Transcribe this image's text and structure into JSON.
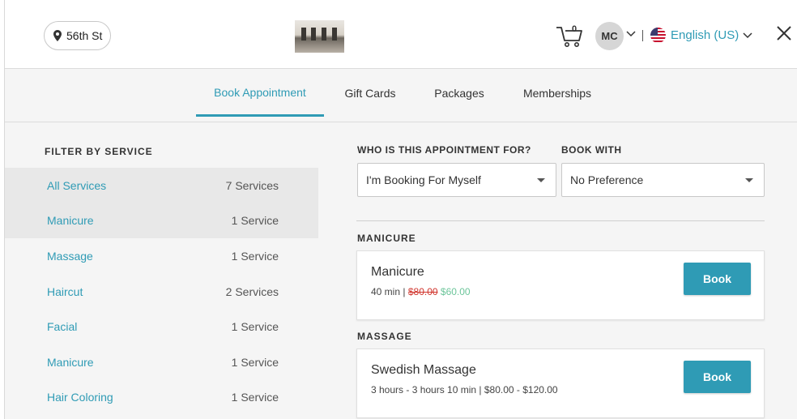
{
  "header": {
    "location": "56th St",
    "cart_count": "0",
    "user_initials": "MC",
    "language": "English (US)"
  },
  "tabs": [
    {
      "label": "Book Appointment",
      "active": true
    },
    {
      "label": "Gift Cards",
      "active": false
    },
    {
      "label": "Packages",
      "active": false
    },
    {
      "label": "Memberships",
      "active": false
    }
  ],
  "sidebar": {
    "title": "FILTER BY SERVICE",
    "items": [
      {
        "name": "All Services",
        "count": "7 Services",
        "selected": true
      },
      {
        "name": "Manicure",
        "count": "1 Service",
        "selected": true
      },
      {
        "name": "Massage",
        "count": "1 Service",
        "selected": false
      },
      {
        "name": "Haircut",
        "count": "2 Services",
        "selected": false
      },
      {
        "name": "Facial",
        "count": "1 Service",
        "selected": false
      },
      {
        "name": "Manicure",
        "count": "1 Service",
        "selected": false
      },
      {
        "name": "Hair Coloring",
        "count": "1 Service",
        "selected": false
      }
    ]
  },
  "booking": {
    "for_label": "WHO IS THIS APPOINTMENT FOR?",
    "for_value": "I'm Booking For Myself",
    "with_label": "BOOK WITH",
    "with_value": "No Preference"
  },
  "sections": [
    {
      "title": "MANICURE",
      "card": {
        "name": "Manicure",
        "duration": "40 min",
        "separator": "|",
        "old_price": "$80.00",
        "new_price": "$60.00",
        "book_label": "Book"
      }
    },
    {
      "title": "MASSAGE",
      "card": {
        "name": "Swedish Massage",
        "details": "3 hours - 3 hours 10 min | $80.00  -  $120.00",
        "book_label": "Book"
      }
    }
  ],
  "colors": {
    "accent": "#2f9bb5",
    "old_price": "#d0342c",
    "new_price": "#6cc59a"
  }
}
